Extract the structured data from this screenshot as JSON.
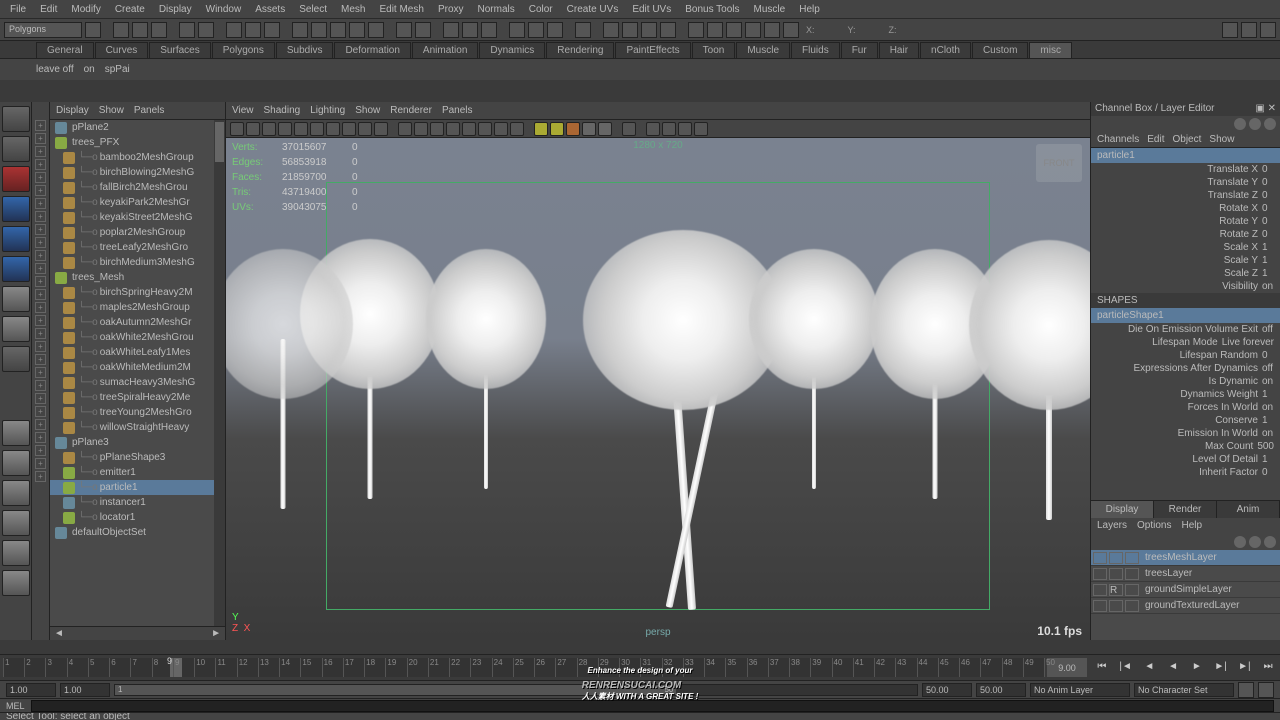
{
  "menu": [
    "File",
    "Edit",
    "Modify",
    "Create",
    "Display",
    "Window",
    "Assets",
    "Select",
    "Mesh",
    "Edit Mesh",
    "Proxy",
    "Normals",
    "Color",
    "Create UVs",
    "Edit UVs",
    "Bonus Tools",
    "Muscle",
    "Help"
  ],
  "mode": "Polygons",
  "coords": {
    "x": "X:",
    "y": "Y:",
    "z": "Z:"
  },
  "shelf_tabs": [
    "General",
    "Curves",
    "Surfaces",
    "Polygons",
    "Subdivs",
    "Deformation",
    "Animation",
    "Dynamics",
    "Rendering",
    "PaintEffects",
    "Toon",
    "Muscle",
    "Fluids",
    "Fur",
    "Hair",
    "nCloth",
    "Custom",
    "misc"
  ],
  "shelf_active": "misc",
  "shelf_items": [
    "leave off",
    "on",
    "spPai"
  ],
  "outliner_menu": [
    "Display",
    "Show",
    "Panels"
  ],
  "outliner": [
    {
      "indent": 0,
      "icon": "grp",
      "name": "pPlane2"
    },
    {
      "indent": 0,
      "icon": "part",
      "name": "trees_PFX"
    },
    {
      "indent": 1,
      "icon": "mesh",
      "name": "bamboo2MeshGroup"
    },
    {
      "indent": 1,
      "icon": "mesh",
      "name": "birchBlowing2MeshG"
    },
    {
      "indent": 1,
      "icon": "mesh",
      "name": "fallBirch2MeshGrou"
    },
    {
      "indent": 1,
      "icon": "mesh",
      "name": "keyakiPark2MeshGr"
    },
    {
      "indent": 1,
      "icon": "mesh",
      "name": "keyakiStreet2MeshG"
    },
    {
      "indent": 1,
      "icon": "mesh",
      "name": "poplar2MeshGroup"
    },
    {
      "indent": 1,
      "icon": "mesh",
      "name": "treeLeafy2MeshGro"
    },
    {
      "indent": 1,
      "icon": "mesh",
      "name": "birchMedium3MeshG"
    },
    {
      "indent": 0,
      "icon": "part",
      "name": "trees_Mesh"
    },
    {
      "indent": 1,
      "icon": "mesh",
      "name": "birchSpringHeavy2M"
    },
    {
      "indent": 1,
      "icon": "mesh",
      "name": "maples2MeshGroup"
    },
    {
      "indent": 1,
      "icon": "mesh",
      "name": "oakAutumn2MeshGr"
    },
    {
      "indent": 1,
      "icon": "mesh",
      "name": "oakWhite2MeshGrou"
    },
    {
      "indent": 1,
      "icon": "mesh",
      "name": "oakWhiteLeafy1Mes"
    },
    {
      "indent": 1,
      "icon": "mesh",
      "name": "oakWhiteMedium2M"
    },
    {
      "indent": 1,
      "icon": "mesh",
      "name": "sumacHeavy3MeshG"
    },
    {
      "indent": 1,
      "icon": "mesh",
      "name": "treeSpiralHeavy2Me"
    },
    {
      "indent": 1,
      "icon": "mesh",
      "name": "treeYoung2MeshGro"
    },
    {
      "indent": 1,
      "icon": "mesh",
      "name": "willowStraightHeavy"
    },
    {
      "indent": 0,
      "icon": "grp",
      "name": "pPlane3"
    },
    {
      "indent": 1,
      "icon": "mesh",
      "name": "pPlaneShape3"
    },
    {
      "indent": 1,
      "icon": "part",
      "name": "emitter1"
    },
    {
      "indent": 1,
      "icon": "part",
      "name": "particle1",
      "sel": true
    },
    {
      "indent": 1,
      "icon": "grp",
      "name": "instancer1"
    },
    {
      "indent": 1,
      "icon": "part",
      "name": "locator1"
    },
    {
      "indent": 0,
      "icon": "grp",
      "name": "defaultObjectSet"
    }
  ],
  "vp_menu": [
    "View",
    "Shading",
    "Lighting",
    "Show",
    "Renderer",
    "Panels"
  ],
  "vp_stats": [
    {
      "label": "Verts:",
      "v1": "37015607",
      "v2": "0"
    },
    {
      "label": "Edges:",
      "v1": "56853918",
      "v2": "0"
    },
    {
      "label": "Faces:",
      "v1": "21859700",
      "v2": "0"
    },
    {
      "label": "Tris:",
      "v1": "43719400",
      "v2": "0"
    },
    {
      "label": "UVs:",
      "v1": "39043075",
      "v2": "0"
    }
  ],
  "vp_res": "1280 x 720",
  "vp_cube": "FRONT",
  "vp_persp": "persp",
  "vp_fps": "10.1 fps",
  "channel_box": {
    "title": "Channel Box / Layer Editor",
    "menu": [
      "Channels",
      "Edit",
      "Object",
      "Show"
    ],
    "node": "particle1",
    "attrs": [
      {
        "n": "Translate X",
        "v": "0"
      },
      {
        "n": "Translate Y",
        "v": "0"
      },
      {
        "n": "Translate Z",
        "v": "0"
      },
      {
        "n": "Rotate X",
        "v": "0"
      },
      {
        "n": "Rotate Y",
        "v": "0"
      },
      {
        "n": "Rotate Z",
        "v": "0"
      },
      {
        "n": "Scale X",
        "v": "1"
      },
      {
        "n": "Scale Y",
        "v": "1"
      },
      {
        "n": "Scale Z",
        "v": "1"
      },
      {
        "n": "Visibility",
        "v": "on"
      }
    ],
    "shapes_label": "SHAPES",
    "shape": "particleShape1",
    "shape_attrs": [
      {
        "n": "Die On Emission Volume Exit",
        "v": "off"
      },
      {
        "n": "Lifespan Mode",
        "v": "Live forever"
      },
      {
        "n": "Lifespan Random",
        "v": "0"
      },
      {
        "n": "Expressions After Dynamics",
        "v": "off"
      },
      {
        "n": "Is Dynamic",
        "v": "on"
      },
      {
        "n": "Dynamics Weight",
        "v": "1"
      },
      {
        "n": "Forces In World",
        "v": "on"
      },
      {
        "n": "Conserve",
        "v": "1"
      },
      {
        "n": "Emission In World",
        "v": "on"
      },
      {
        "n": "Max Count",
        "v": "500"
      },
      {
        "n": "Level Of Detail",
        "v": "1"
      },
      {
        "n": "Inherit Factor",
        "v": "0"
      }
    ],
    "layer_tabs": [
      "Display",
      "Render",
      "Anim"
    ],
    "layer_menu": [
      "Layers",
      "Options",
      "Help"
    ],
    "layers": [
      {
        "name": "treesMeshLayer",
        "flags": [
          "",
          "",
          ""
        ],
        "sel": true
      },
      {
        "name": "treesLayer",
        "flags": [
          "",
          "",
          ""
        ]
      },
      {
        "name": "groundSimpleLayer",
        "flags": [
          "",
          "R",
          ""
        ]
      },
      {
        "name": "groundTexturedLayer",
        "flags": [
          "",
          "",
          ""
        ]
      }
    ]
  },
  "timeline": {
    "start": 1,
    "end": 50,
    "cursor": 9,
    "cursor_label": "9",
    "end_label": "9.00"
  },
  "range": {
    "a": "1.00",
    "b": "1.00",
    "c": "1",
    "d": "50",
    "e": "50.00",
    "f": "50.00",
    "anim": "No Anim Layer",
    "char": "No Character Set"
  },
  "cmd_label": "MEL",
  "status": "Select Tool: select an object",
  "watermark": {
    "top": "Enhance the design of your",
    "main": "RENRENSUCAI.COM",
    "sub": "人人素材    WITH A GREAT SITE !"
  }
}
